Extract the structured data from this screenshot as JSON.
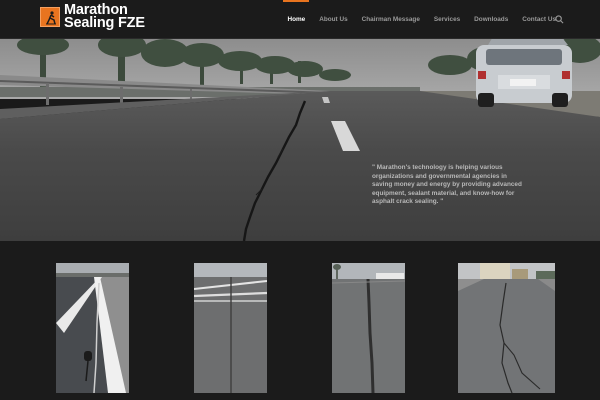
{
  "header": {
    "logo": {
      "line1": "Marathon",
      "line2": "Sealing FZE",
      "icon": "worker-sign-icon"
    },
    "nav": [
      {
        "label": "Home",
        "active": true
      },
      {
        "label": "About Us",
        "active": false
      },
      {
        "label": "Chairman Message",
        "active": false
      },
      {
        "label": "Services",
        "active": false
      },
      {
        "label": "Downloads",
        "active": false
      },
      {
        "label": "Contact Us",
        "active": false
      }
    ],
    "search_icon": "search-icon"
  },
  "hero": {
    "quote": "\" Marathon's technology is helping various organizations  and governmental agencies in saving money  and  energy by providing advanced equipment, sealant material, and know-how for asphalt  crack sealing. \""
  },
  "gallery": {
    "items": [
      {
        "name": "highway-edge-line-photo"
      },
      {
        "name": "runway-joint-photo"
      },
      {
        "name": "sealed-crack-road-photo"
      },
      {
        "name": "street-crack-photo"
      }
    ]
  },
  "colors": {
    "accent": "#e8741f",
    "background": "#1b1b1b",
    "nav_text": "#9a9a9a",
    "nav_active": "#ffffff"
  }
}
